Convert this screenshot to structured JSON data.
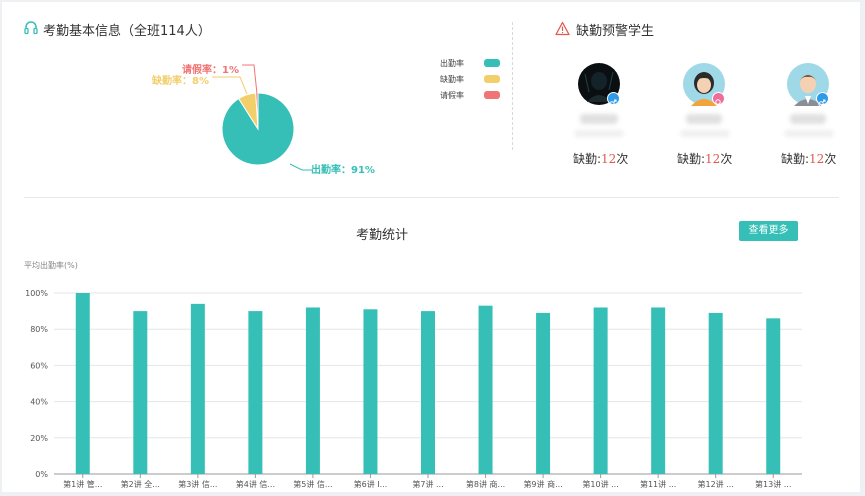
{
  "attendance_info": {
    "title": "考勤基本信息（全班114人）"
  },
  "pie_labels": {
    "leave": "请假率：1%",
    "absent": "缺勤率：8%",
    "present": "出勤率：91%"
  },
  "legend": [
    {
      "label": "出勤率",
      "color": "#35bfb6"
    },
    {
      "label": "缺勤率",
      "color": "#f2cf6b"
    },
    {
      "label": "请假率",
      "color": "#f07474"
    }
  ],
  "warning": {
    "title": "缺勤预警学生",
    "students": [
      {
        "absent_prefix": "缺勤:",
        "absent_count": "12",
        "absent_suffix": "次",
        "gender": "male"
      },
      {
        "absent_prefix": "缺勤:",
        "absent_count": "12",
        "absent_suffix": "次",
        "gender": "female"
      },
      {
        "absent_prefix": "缺勤:",
        "absent_count": "12",
        "absent_suffix": "次",
        "gender": "male"
      }
    ]
  },
  "stats": {
    "title": "考勤统计",
    "more_button": "查看更多"
  },
  "colors": {
    "accent": "#35bfb6",
    "absent": "#f2cf6b",
    "leave": "#f07474",
    "alert": "#e05a4f"
  },
  "chart_data": [
    {
      "type": "pie",
      "categories": [
        "出勤率",
        "缺勤率",
        "请假率"
      ],
      "values": [
        91,
        8,
        1
      ],
      "legend_position": "top-right"
    },
    {
      "type": "bar",
      "ylabel": "平均出勤率(%)",
      "ylim": [
        0,
        100
      ],
      "yticks": [
        "0%",
        "20%",
        "40%",
        "60%",
        "80%",
        "100%"
      ],
      "grid": true,
      "categories": [
        "第1讲 管...",
        "第2讲 全...",
        "第3讲 信...",
        "第4讲 信...",
        "第5讲 信...",
        "第6讲 I...",
        "第7讲 ...",
        "第8讲 商...",
        "第9讲 商...",
        "第10讲 ...",
        "第11讲 ...",
        "第12讲 ...",
        "第13讲 ..."
      ],
      "values": [
        100,
        90,
        94,
        90,
        92,
        91,
        90,
        93,
        89,
        92,
        92,
        89,
        86
      ]
    }
  ]
}
